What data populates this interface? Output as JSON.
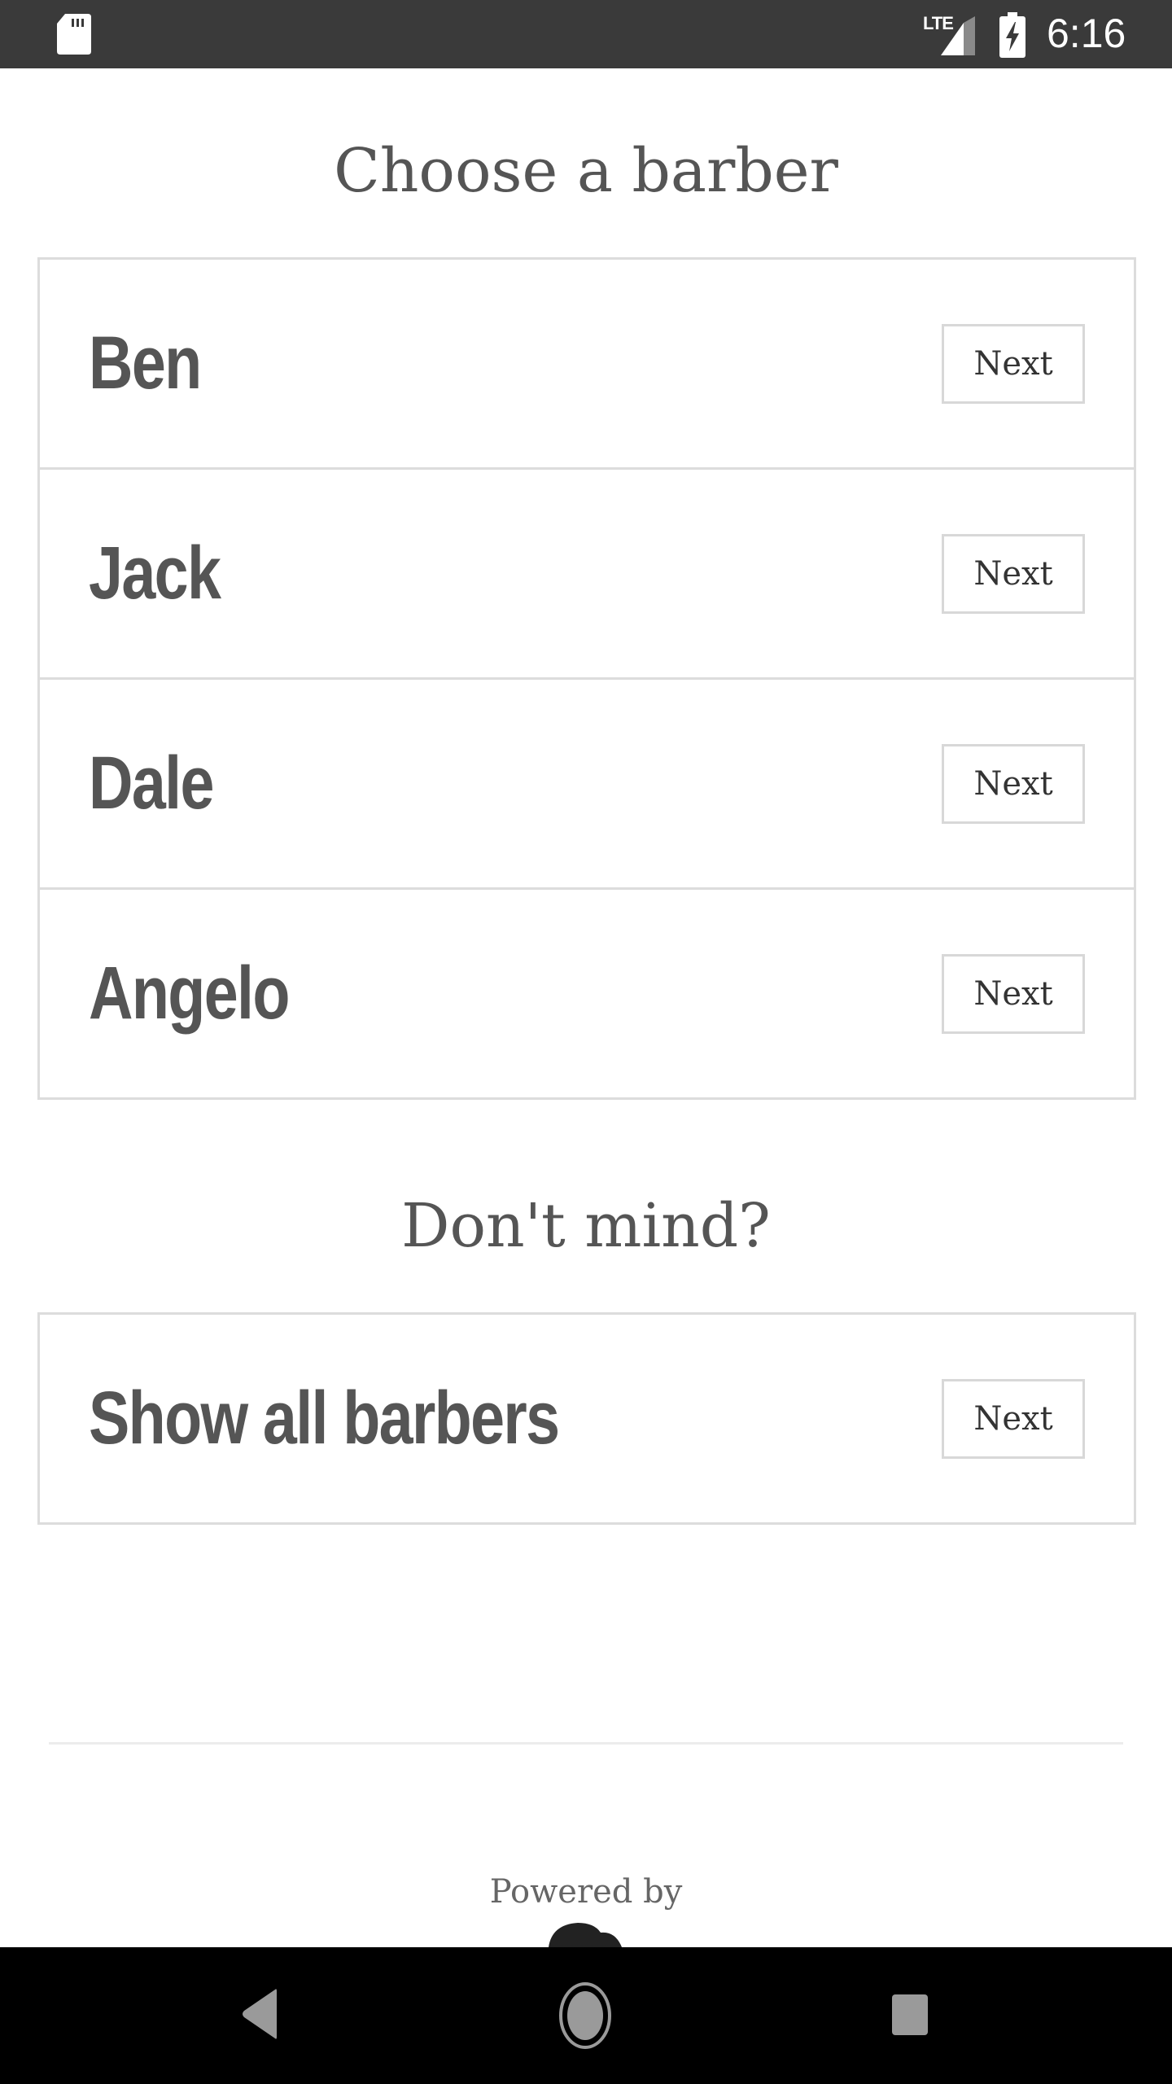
{
  "status_bar": {
    "network_label": "LTE",
    "time": "6:16",
    "icons": [
      "sd-card-icon",
      "signal-icon",
      "battery-charging-icon"
    ]
  },
  "page": {
    "title": "Choose a barber",
    "barbers": [
      {
        "name": "Ben",
        "action_label": "Next"
      },
      {
        "name": "Jack",
        "action_label": "Next"
      },
      {
        "name": "Dale",
        "action_label": "Next"
      },
      {
        "name": "Angelo",
        "action_label": "Next"
      }
    ],
    "subtitle": "Don't mind?",
    "show_all": {
      "name": "Show all barbers",
      "action_label": "Next"
    }
  },
  "footer": {
    "powered_by": "Powered by"
  },
  "nav_bar": {
    "icons": [
      "back-icon",
      "home-icon",
      "recents-icon"
    ]
  },
  "colors": {
    "status_bar_bg": "#3a3a3a",
    "text_primary": "#555555",
    "border": "#dcdcdc",
    "nav_bg": "#000000"
  }
}
